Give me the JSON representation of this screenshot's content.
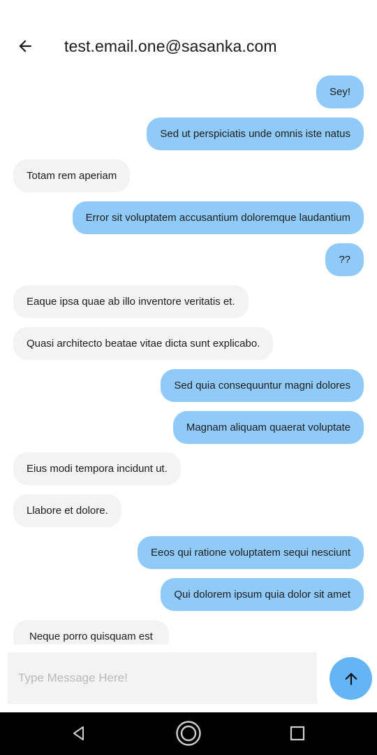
{
  "header": {
    "title": "test.email.one@sasanka.com",
    "back_icon": "arrow-back-icon"
  },
  "messages": [
    {
      "text": "Sey!",
      "sender": "me"
    },
    {
      "text": "Sed ut perspiciatis unde omnis iste natus",
      "sender": "me"
    },
    {
      "text": "Totam rem aperiam",
      "sender": "other"
    },
    {
      "text": "Error sit voluptatem accusantium doloremque laudantium",
      "sender": "me"
    },
    {
      "text": "??",
      "sender": "me"
    },
    {
      "text": "Eaque ipsa quae ab illo inventore veritatis et.",
      "sender": "other"
    },
    {
      "text": "Quasi architecto beatae vitae dicta sunt explicabo.",
      "sender": "other"
    },
    {
      "text": "Sed quia consequuntur magni dolores",
      "sender": "me"
    },
    {
      "text": "Magnam aliquam quaerat voluptate",
      "sender": "me"
    },
    {
      "text": "Eius modi tempora incidunt ut.",
      "sender": "other"
    },
    {
      "text": "Llabore et dolore.",
      "sender": "other"
    },
    {
      "text": "Eeos qui ratione voluptatem sequi nesciunt",
      "sender": "me"
    },
    {
      "text": "Qui dolorem ipsum quia dolor sit amet",
      "sender": "me"
    },
    {
      "text": "Neque porro quisquam est",
      "sender": "other"
    }
  ],
  "composer": {
    "placeholder": "Type Message Here!",
    "value": "",
    "send_icon": "arrow-up-icon"
  },
  "navigation": {
    "back_icon": "triangle-back-icon",
    "home_icon": "circle-home-icon",
    "recents_icon": "square-recents-icon"
  },
  "colors": {
    "outgoing_bubble": "#90caf9",
    "incoming_bubble": "#f3f3f3",
    "send_button": "#64b5f6",
    "nav_bar": "#000000"
  }
}
